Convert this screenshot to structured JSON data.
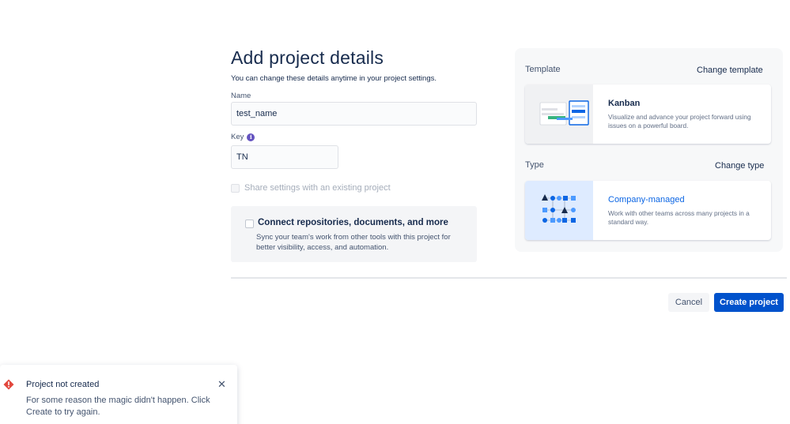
{
  "form": {
    "title": "Add project details",
    "subtitle": "You can change these details anytime in your project settings.",
    "name_label": "Name",
    "name_value": "test_name",
    "key_label": "Key",
    "key_value": "TN",
    "share_label": "Share settings with an existing project",
    "connect": {
      "title": "Connect repositories, documents, and more",
      "description": "Sync your team's work from other tools with this project for better visibility, access, and automation."
    }
  },
  "panel": {
    "template_label": "Template",
    "change_template": "Change template",
    "template_card": {
      "title": "Kanban",
      "description": "Visualize and advance your project forward using issues on a powerful board."
    },
    "type_label": "Type",
    "change_type": "Change type",
    "type_card": {
      "title": "Company-managed",
      "description": "Work with other teams across many projects in a standard way."
    }
  },
  "footer": {
    "cancel_label": "Cancel",
    "create_label": "Create project"
  },
  "toast": {
    "title": "Project not created",
    "description": "For some reason the magic didn't happen. Click Create to try again.",
    "close_icon": "close-icon"
  },
  "colors": {
    "primary": "#0052cc",
    "error": "#e2483d",
    "link": "#0c66e4"
  }
}
